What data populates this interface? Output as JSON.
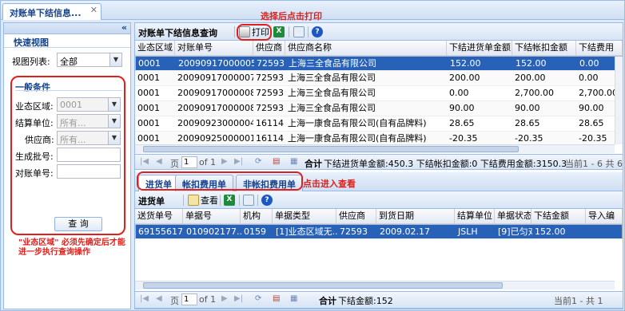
{
  "tab": {
    "title": "对账单下结信息...",
    "close": "✕"
  },
  "left": {
    "collapse": "«",
    "quick_view_title": "快速视图",
    "view_list_label": "视图列表:",
    "view_list_value": "全部",
    "conditions_title": "一般条件",
    "fields": [
      {
        "label": "业态区域:",
        "value": "0001"
      },
      {
        "label": "结算单位:",
        "value": "所有..."
      },
      {
        "label": "供应商:",
        "value": "所有..."
      },
      {
        "label": "生成批号:",
        "value": ""
      },
      {
        "label": "对账单号:",
        "value": ""
      }
    ],
    "query_button": "查 询",
    "note": "\"业态区域\" 必须先确定后才能进一步执行查询操作"
  },
  "top_grid": {
    "title": "对账单下结信息查询",
    "print_label": "打印",
    "annotation": "选择后点击打印",
    "columns": [
      "业态区域",
      "对账单号",
      "供应商",
      "供应商名称",
      "下结进货单金额",
      "下结帐扣金额",
      "下结费用"
    ],
    "rows": [
      [
        "0001",
        "20090917000005",
        "72593",
        "上海三全食品有限公司",
        "152.00",
        "152.00",
        "0.00"
      ],
      [
        "0001",
        "20090917000007",
        "72593",
        "上海三全食品有限公司",
        "200.00",
        "200.00",
        "0.00"
      ],
      [
        "0001",
        "20090917000008",
        "72593",
        "上海三全食品有限公司",
        "0.00",
        "2,700.00",
        "2,700.00"
      ],
      [
        "0001",
        "20090917000008",
        "72593",
        "上海三全食品有限公司",
        "90.00",
        "90.00",
        "90.00"
      ],
      [
        "0001",
        "20090923000004",
        "16114",
        "上海一康食品有限公司(自有品牌料)",
        "28.65",
        "28.65",
        "28.65"
      ],
      [
        "0001",
        "20090925000001",
        "16114",
        "上海一康食品有限公司(自有品牌料)",
        "-20.35",
        "-20.35",
        "-20.35"
      ]
    ],
    "pager": {
      "page_label": "页",
      "page": "1",
      "of": "of 1",
      "total_label": "合计",
      "summary": "下结进货单金额:450.3  下结帐扣金额:0  下结费用金额:3150.3",
      "range": "当前1 - 6 共 6"
    }
  },
  "sub_tabs": [
    "进货单",
    "帐扣费用单",
    "非帐扣费用单"
  ],
  "sub_tab_note": "点击进入查看",
  "bottom_grid": {
    "title": "进货单",
    "view_label": "查看",
    "columns": [
      "送货单号",
      "单据号",
      "机构",
      "单据类型",
      "供应商",
      "到货日期",
      "结算单位",
      "单据状态",
      "下结金额",
      "导入编"
    ],
    "rows": [
      [
        "69155617",
        "010902177...",
        "0159",
        "[1]业态区域无...",
        "72593",
        "2009.02.17",
        "JSLH",
        "[9]已匀对",
        "152.00",
        ""
      ]
    ],
    "pager": {
      "page_label": "页",
      "page": "1",
      "of": "of 1",
      "total_label": "合计",
      "summary": "下结金额:152",
      "range": "当前1 - 共 1"
    }
  },
  "colors": {
    "selected_row": "#2861b8",
    "annotation": "#e0201c",
    "header_text": "#15428b"
  }
}
